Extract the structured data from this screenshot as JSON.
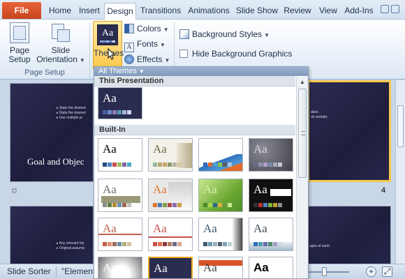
{
  "ribbon": {
    "file_tab": "File",
    "tabs": [
      "Home",
      "Insert",
      "Design",
      "Transitions",
      "Animations",
      "Slide Show",
      "Review",
      "View",
      "Add-Ins"
    ],
    "active_tab": "Design",
    "page_setup_label": "Page\nSetup",
    "page_setup_l1": "Page",
    "page_setup_l2": "Setup",
    "slide_orientation_l1": "Slide",
    "slide_orientation_l2": "Orientation",
    "page_setup_group": "Page Setup",
    "themes_label": "Themes",
    "colors_label": "Colors",
    "fonts_label": "Fonts",
    "effects_label": "Effects",
    "background_styles_label": "Background Styles",
    "hide_background_graphics_label": "Hide Background Graphics",
    "hide_background_graphics_checked": false
  },
  "themes_dropdown": {
    "header": "All Themes",
    "section_this": "This Presentation",
    "section_builtin": "Built-In",
    "glyph": "Aa",
    "current_theme": {
      "bg": "#2a2d4f",
      "fg": "#ffffff",
      "swatches": [
        "#4a5ea8",
        "#6f8cc8",
        "#8a7fb5",
        "#5b9bb5",
        "#a8b4d8",
        "#cfd6ea"
      ]
    },
    "builtin": [
      {
        "bg": "#ffffff",
        "fg": "#000000",
        "swatches": [
          "#1f497d",
          "#4f81bd",
          "#c0504d",
          "#9bbb59",
          "#8064a2",
          "#4bacc6"
        ]
      },
      {
        "bg": "#f4f1ea",
        "fg": "#6b6b45",
        "swatches": [
          "#94b6a3",
          "#b4a86c",
          "#c8a46a",
          "#8c9a6b",
          "#b8b6a0",
          "#d6c9a4"
        ]
      },
      {
        "bg": "#ffffff",
        "fg": "#ffffff",
        "swatches": [
          "#2f6dbe",
          "#e26b2a",
          "#54a0d8",
          "#8bc34a",
          "#5a5a5a",
          "#a5c4e8"
        ]
      },
      {
        "bg": "#5c5c64",
        "fg": "#d8d8dc",
        "swatches": [
          "#6b6b8b",
          "#9090b0",
          "#b0a0c8",
          "#7a8ab0",
          "#a8a8b8",
          "#c8c8d8"
        ]
      },
      {
        "bg": "#ffffff",
        "fg": "#6d6d6d",
        "swatches": [
          "#8a8a8a",
          "#5f7f3f",
          "#b58b2e",
          "#6a8fb0",
          "#9a6a5a",
          "#c0c0c0"
        ]
      },
      {
        "bg": "#e8e8e8",
        "fg": "#e0752e",
        "swatches": [
          "#e0752e",
          "#4a7ab0",
          "#7fa24a",
          "#b04a4a",
          "#8a6ab0",
          "#c8a040"
        ]
      },
      {
        "bg": "#8cc03c",
        "fg": "#d8f0a8",
        "swatches": [
          "#4c8a2c",
          "#a8d050",
          "#2c6a8a",
          "#d8b040",
          "#6a9a3c",
          "#c8e890"
        ]
      },
      {
        "bg": "#101010",
        "fg": "#ffffff",
        "swatches": [
          "#303030",
          "#c03030",
          "#5080c0",
          "#80b040",
          "#c0a030",
          "#909090"
        ]
      },
      {
        "bg": "#ffffff",
        "fg": "#c06050",
        "swatches": [
          "#c06050",
          "#e09070",
          "#9a6a5a",
          "#6a8aa0",
          "#b0b080",
          "#d8c0a8"
        ]
      },
      {
        "bg": "#ffffff",
        "fg": "#c0504d",
        "swatches": [
          "#c0504d",
          "#e07050",
          "#8a3a3a",
          "#b08060",
          "#6a6a8a",
          "#d8a890"
        ]
      },
      {
        "bg": "#ffffff",
        "fg": "#3a5a70",
        "swatches": [
          "#3a5a70",
          "#6a9ab0",
          "#9ab0c0",
          "#506070",
          "#80a0b8",
          "#c0d0d8"
        ]
      },
      {
        "bg": "#ffffff",
        "fg": "#404a56",
        "swatches": [
          "#2f6dbe",
          "#4aa0b0",
          "#6a6ab0",
          "#4a8a6a",
          "#a0a0c0",
          "#c8d8e8"
        ]
      },
      {
        "bg": "#d8d8d8",
        "fg": "#ffffff",
        "swatches": []
      },
      {
        "bg": "#2a2d4f",
        "fg": "#ffffff",
        "swatches": []
      },
      {
        "bg": "#ffffff",
        "fg": "#404040",
        "swatches": []
      },
      {
        "bg": "#ffffff",
        "fg": "#000000",
        "swatches": []
      }
    ]
  },
  "sorter": {
    "slide_title": "Goal and Objec",
    "slide_number": "4",
    "bullets_top_left": [
      "State the desired",
      "State the desired",
      "Use multiple pr"
    ],
    "bullets_top_right": [
      "ation.",
      "ds verbally"
    ],
    "bullets_bottom_left": [
      "Any relevant his",
      "Original assump"
    ],
    "bullets_bottom_right": [
      "ages at each."
    ]
  },
  "status": {
    "view_label": "Slide Sorter",
    "theme_name": "\"Element"
  }
}
